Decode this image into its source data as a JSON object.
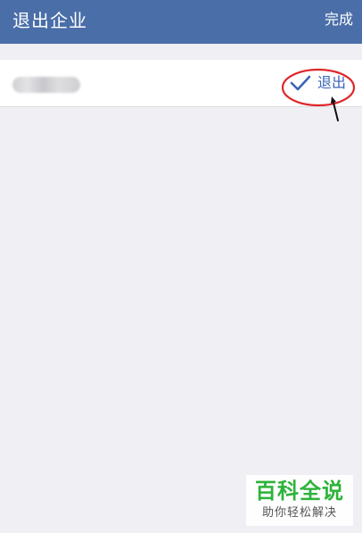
{
  "navbar": {
    "title": "退出企业",
    "done_label": "完成"
  },
  "row": {
    "exit_label": "退出",
    "check_icon": "checkmark-icon"
  },
  "annotation": {
    "circle_color": "#e0262b",
    "arrow_color": "#111111"
  },
  "watermark": {
    "main": "百科全说",
    "sub": "助你轻松解决"
  },
  "colors": {
    "navbar_bg": "#4a6ea8",
    "page_bg": "#efeff4",
    "accent": "#3a64b8"
  }
}
